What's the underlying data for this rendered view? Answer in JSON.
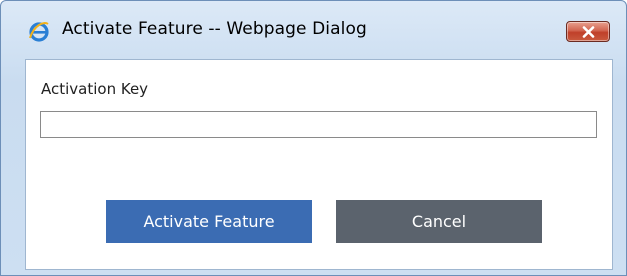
{
  "window": {
    "title": "Activate Feature -- Webpage Dialog",
    "icon": "internet-explorer-icon",
    "close_icon": "close-icon"
  },
  "form": {
    "activation_key_label": "Activation Key",
    "activation_key_value": "",
    "activation_key_placeholder": ""
  },
  "buttons": {
    "activate_label": "Activate Feature",
    "cancel_label": "Cancel"
  },
  "colors": {
    "activate_button": "#3b6cb3",
    "cancel_button": "#5b636d",
    "close_button": "#c9503a"
  }
}
